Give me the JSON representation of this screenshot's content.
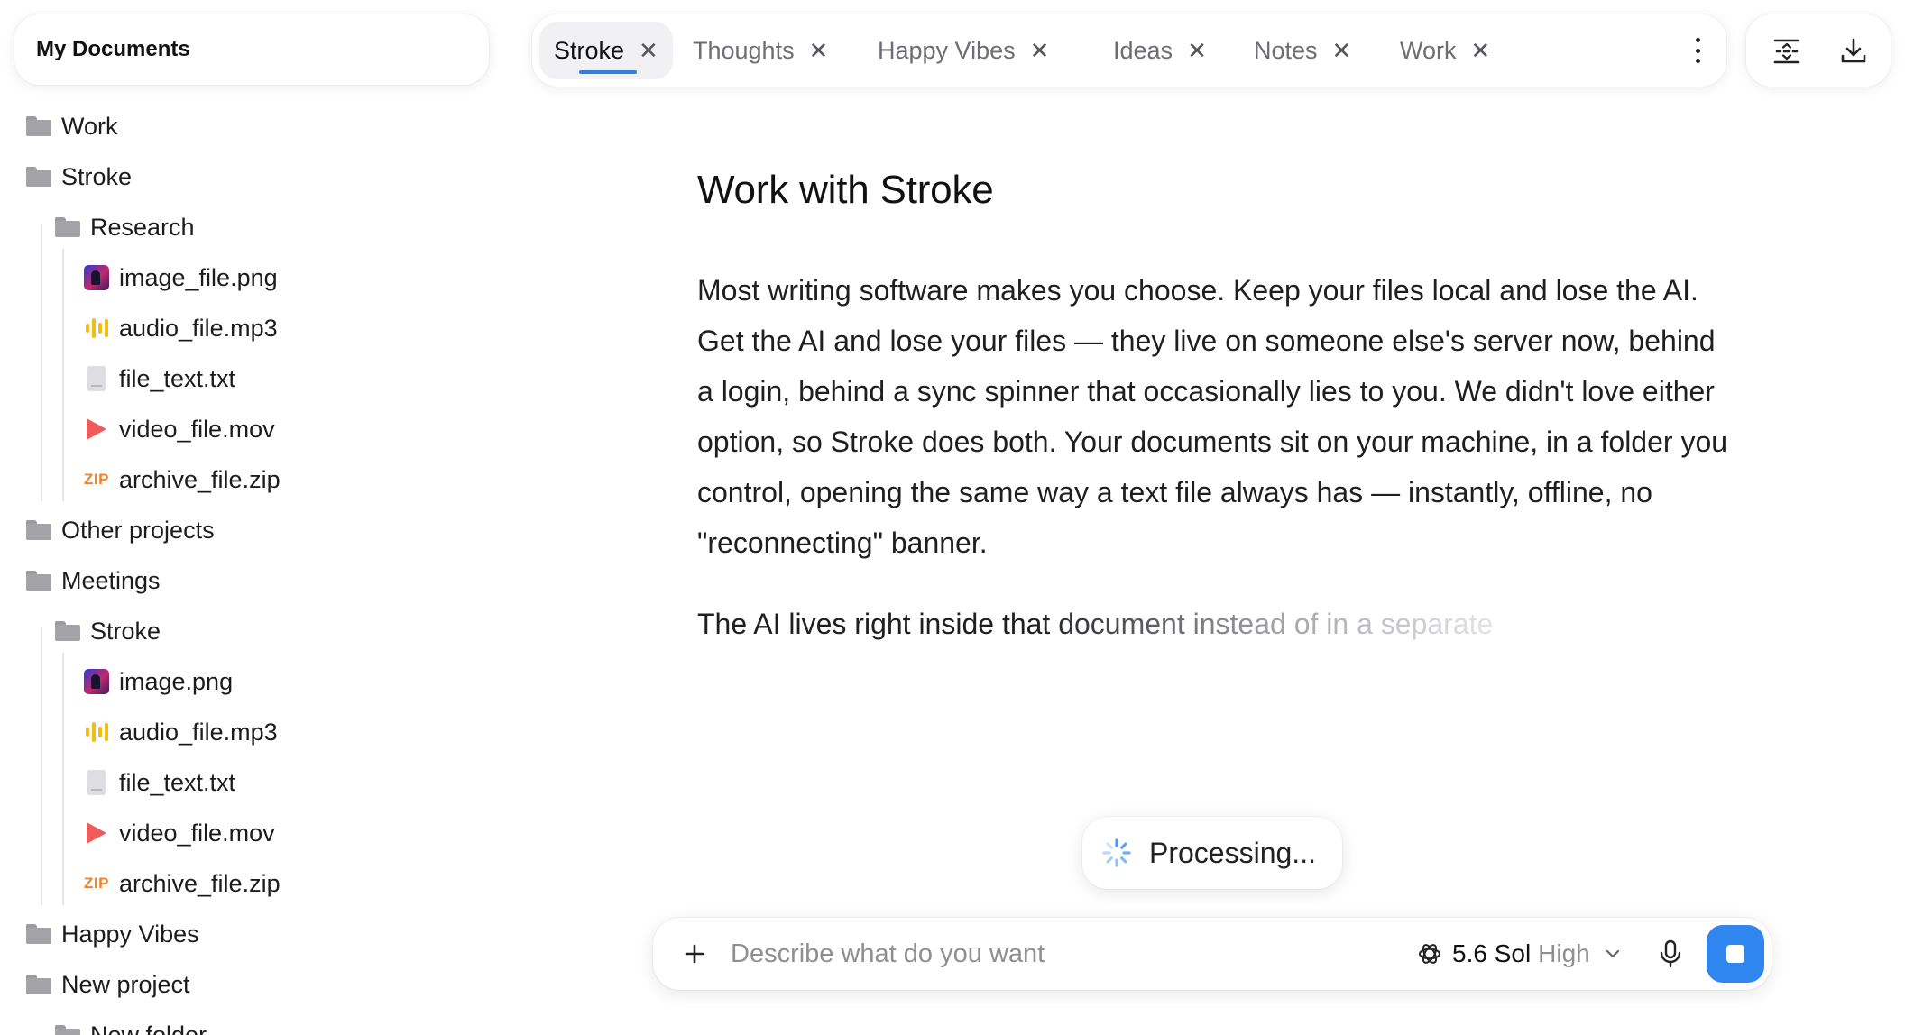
{
  "sidebar": {
    "title": "My Documents",
    "items": [
      {
        "label": "Work",
        "type": "folder",
        "icon": "folder-icon"
      },
      {
        "label": "Stroke",
        "type": "folder",
        "icon": "folder-icon"
      },
      {
        "label": "Research",
        "type": "folder",
        "icon": "folder-icon"
      },
      {
        "label": "image_file.png",
        "type": "image",
        "icon": "image-icon"
      },
      {
        "label": "audio_file.mp3",
        "type": "audio",
        "icon": "audio-icon"
      },
      {
        "label": "file_text.txt",
        "type": "text",
        "icon": "text-file-icon"
      },
      {
        "label": "video_file.mov",
        "type": "video",
        "icon": "video-icon"
      },
      {
        "label": "archive_file.zip",
        "type": "zip",
        "icon": "zip-icon",
        "badge": "ZIP"
      },
      {
        "label": "Other projects",
        "type": "folder",
        "icon": "folder-icon"
      },
      {
        "label": "Meetings",
        "type": "folder",
        "icon": "folder-icon"
      },
      {
        "label": "Stroke",
        "type": "folder",
        "icon": "folder-icon"
      },
      {
        "label": "image.png",
        "type": "image",
        "icon": "image-icon"
      },
      {
        "label": "audio_file.mp3",
        "type": "audio",
        "icon": "audio-icon"
      },
      {
        "label": "file_text.txt",
        "type": "text",
        "icon": "text-file-icon"
      },
      {
        "label": "video_file.mov",
        "type": "video",
        "icon": "video-icon"
      },
      {
        "label": "archive_file.zip",
        "type": "zip",
        "icon": "zip-icon",
        "badge": "ZIP"
      },
      {
        "label": "Happy Vibes",
        "type": "folder",
        "icon": "folder-icon"
      },
      {
        "label": "New project",
        "type": "folder",
        "icon": "folder-icon"
      },
      {
        "label": "New folder",
        "type": "folder",
        "icon": "folder-icon"
      }
    ]
  },
  "tabs": [
    {
      "label": "Stroke",
      "active": true
    },
    {
      "label": "Thoughts",
      "active": false
    },
    {
      "label": "Happy Vibes",
      "active": false
    },
    {
      "label": "Ideas",
      "active": false
    },
    {
      "label": "Notes",
      "active": false
    },
    {
      "label": "Work",
      "active": false
    }
  ],
  "tab_close_glyph": "✕",
  "document": {
    "title": "Work with Stroke",
    "paragraph1": "Most writing software makes you choose. Keep your files local and lose the AI. Get the AI and lose your files — they live on someone else's server now, behind a login, behind a sync spinner that occasionally lies to you. We didn't love either option, so Stroke does both. Your documents sit on your machine, in a folder you control, opening the same way a text file always has — instantly, offline, no \"reconnecting\" banner.",
    "paragraph2": "The AI lives right inside that document instead of in a separate"
  },
  "status": {
    "label": "Processing..."
  },
  "composer": {
    "placeholder": "Describe what do you want",
    "model_name": "5.6 Sol",
    "effort": "High"
  },
  "colors": {
    "accent": "#2f86ef",
    "tab_underline": "#2f7fe8",
    "folder": "#a3a3a8",
    "audio": "#f2bc1b",
    "video": "#ee5b5b",
    "zip": "#f0822a"
  }
}
